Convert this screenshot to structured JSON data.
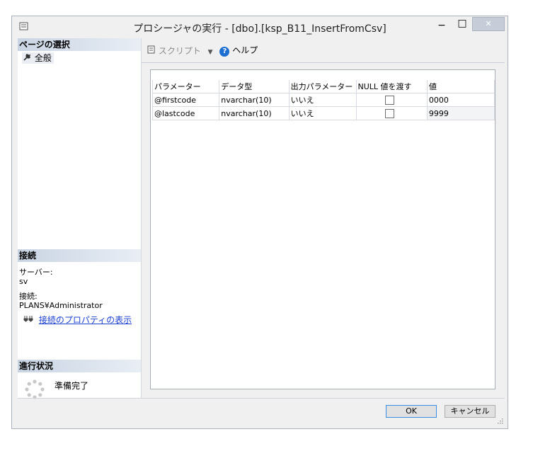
{
  "window": {
    "title": "プロシージャの実行 - [dbo].[ksp_B11_InsertFromCsv]",
    "minimize_glyph": "−",
    "maximize_glyph": "□",
    "close_glyph": "✕"
  },
  "left_pane": {
    "select_page_header": "ページの選択",
    "pages": [
      {
        "label": "全般",
        "icon": "wrench-icon"
      }
    ],
    "connection_header": "接続",
    "server_label": "サーバー:",
    "server_value": "sv",
    "connection_label": "接続:",
    "connection_value": "PLANS¥Administrator",
    "view_connection_properties": "接続のプロパティの表示",
    "progress_header": "進行状況",
    "progress_status": "準備完了"
  },
  "toolbar": {
    "script_label": "スクリプト",
    "help_label": "ヘルプ"
  },
  "table": {
    "columns": [
      "パラメーター",
      "データ型",
      "出力パラメーター",
      "NULL 値を渡す",
      "値"
    ],
    "rows": [
      {
        "parameter": "@firstcode",
        "data_type": "nvarchar(10)",
        "output": "いいえ",
        "pass_null": false,
        "value": "0000"
      },
      {
        "parameter": "@lastcode",
        "data_type": "nvarchar(10)",
        "output": "いいえ",
        "pass_null": false,
        "value": "9999"
      }
    ]
  },
  "buttons": {
    "ok": "OK",
    "cancel": "キャンセル"
  },
  "colors": {
    "link": "#1a3fd0",
    "section_header": "#c9d4e3",
    "help_icon": "#1c6fd0"
  }
}
